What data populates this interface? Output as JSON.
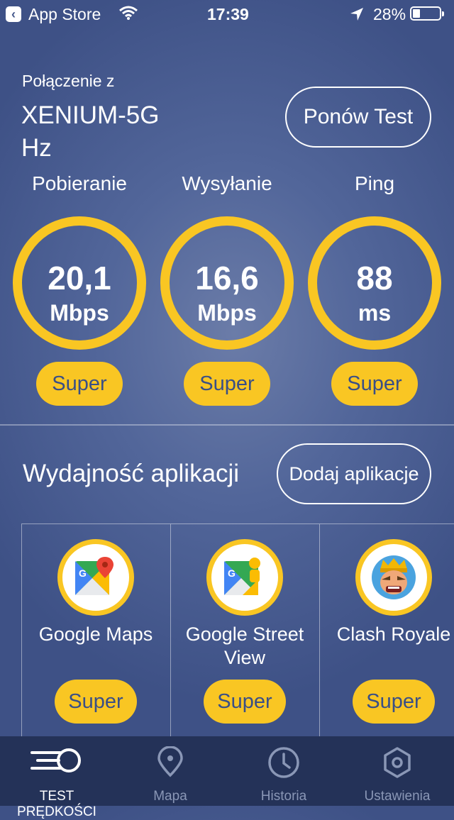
{
  "status_bar": {
    "back_app": "App Store",
    "time": "17:39",
    "battery": "28%",
    "battery_level": 0.28
  },
  "connection": {
    "label": "Połączenie z",
    "network_line1": "XENIUM-5G",
    "network_line2": "Hz",
    "retest_label": "Ponów Test"
  },
  "metrics": [
    {
      "label": "Pobieranie",
      "value": "20,1",
      "unit": "Mbps",
      "rating": "Super"
    },
    {
      "label": "Wysyłanie",
      "value": "16,6",
      "unit": "Mbps",
      "rating": "Super"
    },
    {
      "label": "Ping",
      "value": "88",
      "unit": "ms",
      "rating": "Super"
    }
  ],
  "apps_section": {
    "title": "Wydajność aplikacji",
    "add_label": "Dodaj aplikacje",
    "apps": [
      {
        "name_line1": "Google Maps",
        "name_line2": "",
        "rating": "Super",
        "icon": "google-maps-icon"
      },
      {
        "name_line1": "Google Street",
        "name_line2": "View",
        "rating": "Super",
        "icon": "google-street-view-icon"
      },
      {
        "name_line1": "Clash Royale",
        "name_line2": "",
        "rating": "Super",
        "icon": "clash-royale-icon"
      }
    ]
  },
  "tabbar": {
    "tabs": [
      {
        "label": "TEST PRĘDKOŚCI",
        "icon": "speed-icon",
        "active": true
      },
      {
        "label": "Mapa",
        "icon": "map-pin-icon",
        "active": false
      },
      {
        "label": "Historia",
        "icon": "clock-icon",
        "active": false
      },
      {
        "label": "Ustawienia",
        "icon": "hexagon-gear-icon",
        "active": false
      }
    ]
  },
  "colors": {
    "accent": "#f9c623",
    "background": "#4d6196",
    "tabbar": "#243258",
    "inactive": "#8a97b6"
  }
}
